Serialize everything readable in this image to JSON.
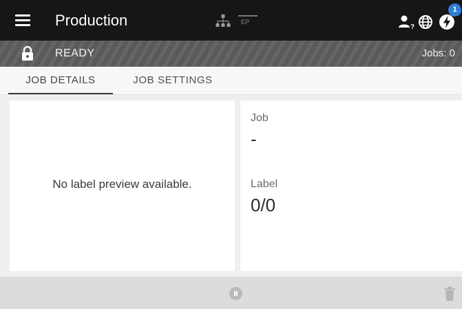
{
  "header": {
    "title": "Production",
    "network_icon": "network-tree-icon",
    "ep_label": "EP",
    "user_icon": "user-help-icon",
    "globe_icon": "globe-icon",
    "power_icon": "power-bolt-icon",
    "notification_count": "1"
  },
  "status": {
    "lock_icon": "lock-icon",
    "state": "READY",
    "jobs": "Jobs: 0"
  },
  "tabs": [
    {
      "label": "JOB DETAILS",
      "active": true
    },
    {
      "label": "JOB SETTINGS",
      "active": false
    }
  ],
  "preview": {
    "message": "No label preview available."
  },
  "details": {
    "job_label": "Job",
    "job_value": "-",
    "label_label": "Label",
    "label_value": "0/0"
  },
  "footer": {
    "pause_icon": "pause-icon",
    "trash_icon": "trash-icon"
  },
  "colors": {
    "topbar": "#161616",
    "statusbar": "#5a5a5a",
    "badge": "#2f7ed8",
    "bottombar": "#dcdcdc"
  }
}
